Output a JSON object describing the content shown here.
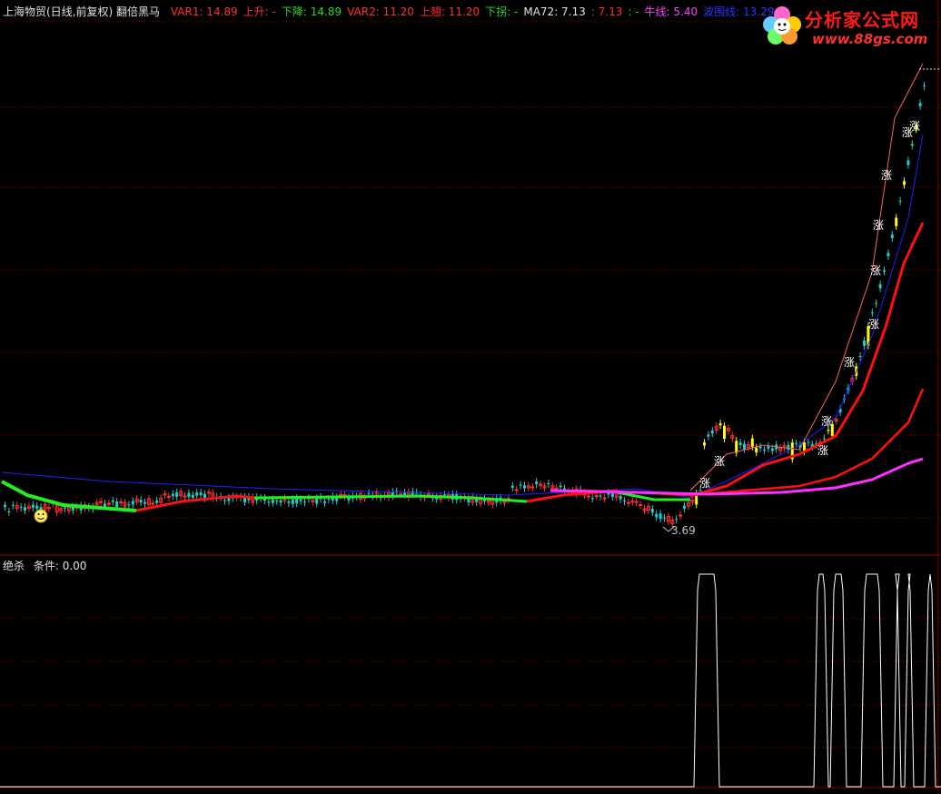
{
  "header": {
    "stock_title": "上海物贸(日线,前复权) 翻倍黑马",
    "indicators": [
      {
        "label": "VAR1: 14.89",
        "color": "#ff3030"
      },
      {
        "label": "上升: -",
        "color": "#ff3030"
      },
      {
        "label": "下降: 14.89",
        "color": "#22dd22"
      },
      {
        "label": "VAR2: 11.20",
        "color": "#ff3030"
      },
      {
        "label": "上翘: 11.20",
        "color": "#ff3030"
      },
      {
        "label": "下拐: -",
        "color": "#22dd22"
      },
      {
        "label": "MA72: 7.13",
        "color": "#e0e0e0"
      },
      {
        "label": ": 7.13",
        "color": "#ff3030"
      },
      {
        "label": ": -",
        "color": "#22dd22"
      },
      {
        "label": "牛线: 5.40",
        "color": "#ff40ff"
      },
      {
        "label": "波围线: 13.29",
        "color": "#3030ff"
      }
    ]
  },
  "sub_header": {
    "name": "绝杀",
    "condition": "条件: 0.00"
  },
  "annotations": {
    "low_price": "3.69",
    "rise_mark": "涨"
  },
  "logo": {
    "line1": "分析家公式网",
    "line2": "www.88gs.com"
  },
  "colors": {
    "background": "#000000",
    "grid": "#800000",
    "up_candle": "#ff3030",
    "down_candle": "#22cccc",
    "signal_candle": "#ffff00",
    "ma_blue": "#2020ff",
    "ma_red": "#ff1010",
    "ma_magenta": "#ff30ff",
    "green_line": "#22ee22",
    "sub_line": "#ffffff"
  }
}
